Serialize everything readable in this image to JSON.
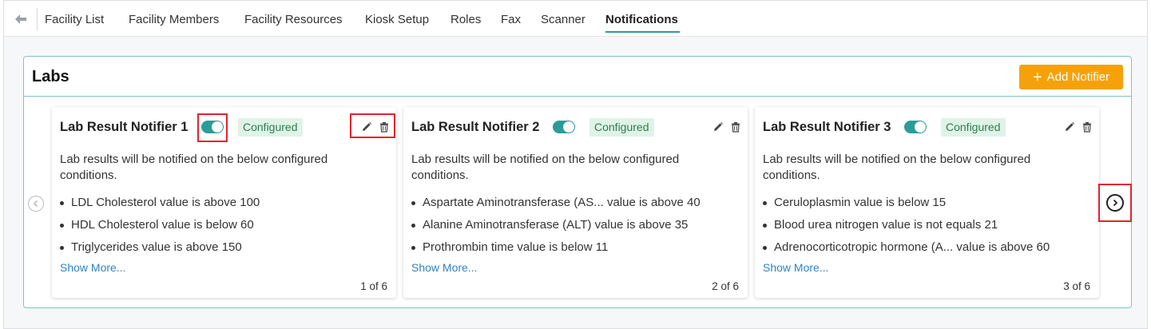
{
  "nav": {
    "tabs": [
      {
        "label": "Facility List"
      },
      {
        "label": "Facility Members"
      },
      {
        "label": "Facility Resources"
      },
      {
        "label": "Kiosk Setup"
      },
      {
        "label": "Roles"
      },
      {
        "label": "Fax"
      },
      {
        "label": "Scanner"
      },
      {
        "label": "Notifications"
      }
    ],
    "active_tab": "Notifications"
  },
  "section": {
    "title": "Labs",
    "add_label": "Add Notifier"
  },
  "cards": [
    {
      "title": "Lab Result Notifier 1",
      "enabled": true,
      "status": "Configured",
      "description": "Lab results will be notified on the below configured conditions.",
      "conditions": [
        "LDL Cholesterol value is above 100",
        "HDL Cholesterol value is below 60",
        "Triglycerides value is above 150"
      ],
      "show_more": "Show More...",
      "pager": "1 of 6"
    },
    {
      "title": "Lab Result Notifier 2",
      "enabled": true,
      "status": "Configured",
      "description": "Lab results will be notified on the below configured conditions.",
      "conditions": [
        "Aspartate Aminotransferase (AS... value is above 40",
        "Alanine Aminotransferase (ALT) value is above 35",
        "Prothrombin time value is below 11"
      ],
      "show_more": "Show More...",
      "pager": "2 of 6"
    },
    {
      "title": "Lab Result Notifier 3",
      "enabled": true,
      "status": "Configured",
      "description": "Lab results will be notified on the below configured conditions.",
      "conditions": [
        "Ceruloplasmin value is below 15",
        "Blood urea nitrogen value is not equals 21",
        "Adrenocorticotropic hormone (A... value is above 60"
      ],
      "show_more": "Show More...",
      "pager": "3 of 6"
    }
  ],
  "colors": {
    "accent": "#2a9d9a",
    "add_button": "#f5a20a",
    "badge_bg": "#dff3e6",
    "badge_text": "#2e7d4f",
    "link": "#2d85c5",
    "highlight": "#e0242f"
  },
  "icons": {
    "back": "arrow-left-icon",
    "add": "plus-icon",
    "edit": "pencil-icon",
    "delete": "trash-icon",
    "prev": "chevron-left-circle-icon",
    "next": "chevron-right-circle-icon"
  }
}
